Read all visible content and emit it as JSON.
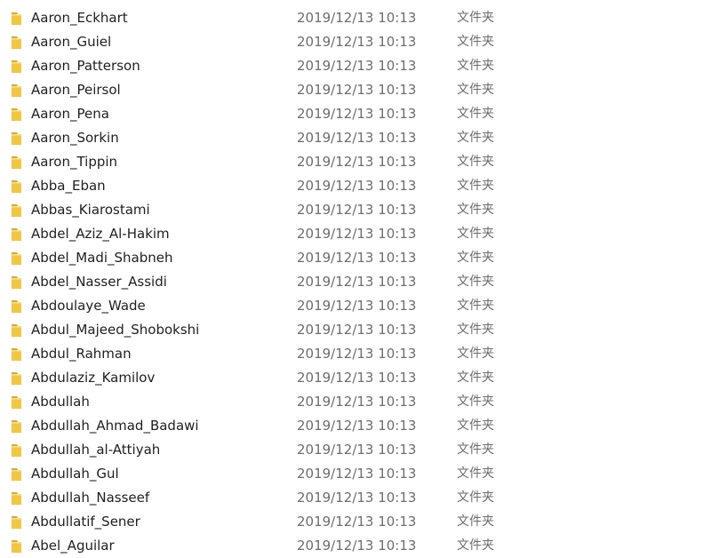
{
  "files": [
    {
      "name": "Aaron_Eckhart",
      "date": "2019/12/13 10:13",
      "type": "文件夹",
      "icon": "folder-icon"
    },
    {
      "name": "Aaron_Guiel",
      "date": "2019/12/13 10:13",
      "type": "文件夹",
      "icon": "folder-icon"
    },
    {
      "name": "Aaron_Patterson",
      "date": "2019/12/13 10:13",
      "type": "文件夹",
      "icon": "folder-icon"
    },
    {
      "name": "Aaron_Peirsol",
      "date": "2019/12/13 10:13",
      "type": "文件夹",
      "icon": "folder-icon"
    },
    {
      "name": "Aaron_Pena",
      "date": "2019/12/13 10:13",
      "type": "文件夹",
      "icon": "folder-icon"
    },
    {
      "name": "Aaron_Sorkin",
      "date": "2019/12/13 10:13",
      "type": "文件夹",
      "icon": "folder-icon"
    },
    {
      "name": "Aaron_Tippin",
      "date": "2019/12/13 10:13",
      "type": "文件夹",
      "icon": "folder-icon"
    },
    {
      "name": "Abba_Eban",
      "date": "2019/12/13 10:13",
      "type": "文件夹",
      "icon": "folder-icon"
    },
    {
      "name": "Abbas_Kiarostami",
      "date": "2019/12/13 10:13",
      "type": "文件夹",
      "icon": "folder-icon"
    },
    {
      "name": "Abdel_Aziz_Al-Hakim",
      "date": "2019/12/13 10:13",
      "type": "文件夹",
      "icon": "folder-icon"
    },
    {
      "name": "Abdel_Madi_Shabneh",
      "date": "2019/12/13 10:13",
      "type": "文件夹",
      "icon": "folder-icon"
    },
    {
      "name": "Abdel_Nasser_Assidi",
      "date": "2019/12/13 10:13",
      "type": "文件夹",
      "icon": "folder-icon"
    },
    {
      "name": "Abdoulaye_Wade",
      "date": "2019/12/13 10:13",
      "type": "文件夹",
      "icon": "folder-icon"
    },
    {
      "name": "Abdul_Majeed_Shobokshi",
      "date": "2019/12/13 10:13",
      "type": "文件夹",
      "icon": "folder-icon"
    },
    {
      "name": "Abdul_Rahman",
      "date": "2019/12/13 10:13",
      "type": "文件夹",
      "icon": "folder-icon"
    },
    {
      "name": "Abdulaziz_Kamilov",
      "date": "2019/12/13 10:13",
      "type": "文件夹",
      "icon": "folder-icon"
    },
    {
      "name": "Abdullah",
      "date": "2019/12/13 10:13",
      "type": "文件夹",
      "icon": "folder-icon"
    },
    {
      "name": "Abdullah_Ahmad_Badawi",
      "date": "2019/12/13 10:13",
      "type": "文件夹",
      "icon": "folder-icon"
    },
    {
      "name": "Abdullah_al-Attiyah",
      "date": "2019/12/13 10:13",
      "type": "文件夹",
      "icon": "folder-icon"
    },
    {
      "name": "Abdullah_Gul",
      "date": "2019/12/13 10:13",
      "type": "文件夹",
      "icon": "folder-icon"
    },
    {
      "name": "Abdullah_Nasseef",
      "date": "2019/12/13 10:13",
      "type": "文件夹",
      "icon": "folder-icon"
    },
    {
      "name": "Abdullatif_Sener",
      "date": "2019/12/13 10:13",
      "type": "文件夹",
      "icon": "folder-icon"
    },
    {
      "name": "Abel_Aguilar",
      "date": "2019/12/13 10:13",
      "type": "文件夹",
      "icon": "folder-icon"
    }
  ],
  "colors": {
    "folder_body": "#f3c642",
    "folder_dark": "#e0a928",
    "folder_light": "#fbe38b",
    "name_text": "#1f1f1f",
    "meta_text": "#6d6d6d"
  }
}
